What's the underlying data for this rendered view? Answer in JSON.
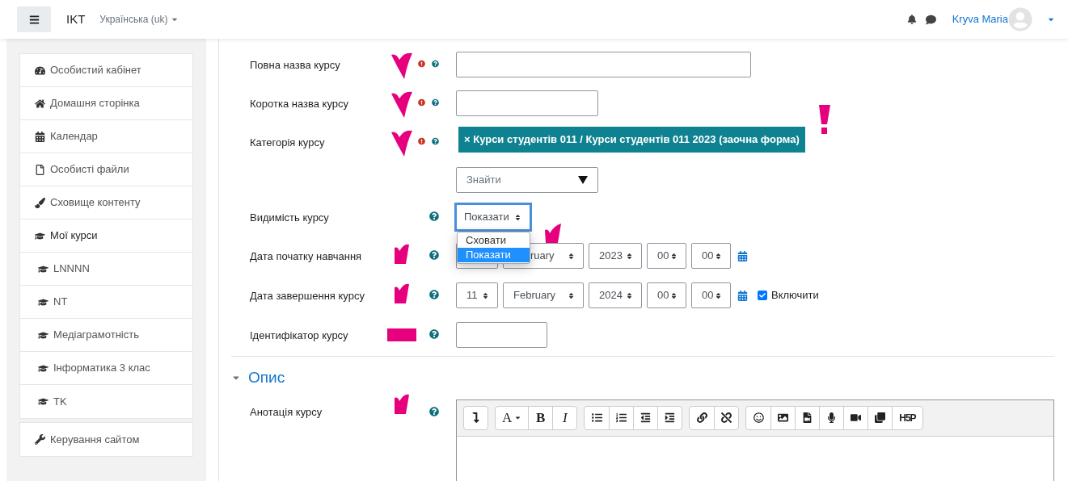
{
  "navbar": {
    "site_name": "IKT",
    "language": "Українська (uk)",
    "user_name": "Kryva Maria"
  },
  "sidebar": {
    "items": [
      {
        "label": "Особистий кабінет",
        "indented": false,
        "selected": false
      },
      {
        "label": "Домашня сторінка",
        "indented": false,
        "selected": false
      },
      {
        "label": "Календар",
        "indented": false,
        "selected": false
      },
      {
        "label": "Особисті файли",
        "indented": false,
        "selected": false
      },
      {
        "label": "Сховище контенту",
        "indented": false,
        "selected": false
      },
      {
        "label": "Мої курси",
        "indented": false,
        "selected": true
      },
      {
        "label": "LNNNN",
        "indented": true,
        "selected": false
      },
      {
        "label": "NT",
        "indented": true,
        "selected": false
      },
      {
        "label": "Медіаграмотність",
        "indented": true,
        "selected": false
      },
      {
        "label": "Інформатика 3 клас",
        "indented": true,
        "selected": false
      },
      {
        "label": "TK",
        "indented": true,
        "selected": false
      }
    ],
    "admin_items": [
      {
        "label": "Керування сайтом",
        "selected": false
      }
    ]
  },
  "form": {
    "rows": [
      {
        "kind": "text",
        "label": "Повна назва курсу",
        "required": true
      },
      {
        "kind": "text",
        "label": "Коротка назва курсу",
        "required": true
      },
      {
        "kind": "category",
        "label": "Категорія курсу",
        "required": true,
        "chip": "× Курси студентів 011 / Курси студентів 011 2023 (заочна форма)",
        "search_placeholder": "Знайти"
      },
      {
        "kind": "select",
        "label": "Видимість курсу",
        "required": false,
        "value": "Показати",
        "focused": true,
        "expanded": true,
        "options": [
          {
            "label": "Сховати",
            "selected": false
          },
          {
            "label": "Показати",
            "selected": true
          }
        ]
      },
      {
        "kind": "date",
        "label": "Дата початку навчання",
        "required": false,
        "parts": [
          {
            "value": "ruary"
          },
          {
            "value": "2023"
          },
          {
            "value": "00"
          },
          {
            "value": "00"
          }
        ]
      },
      {
        "kind": "date",
        "label": "Дата завершення курсу",
        "required": false,
        "parts": [
          {
            "value": "11"
          },
          {
            "value": "February"
          },
          {
            "value": "2024"
          },
          {
            "value": "00"
          },
          {
            "value": "00"
          }
        ],
        "enable": {
          "label": "Включити",
          "checked": true
        }
      },
      {
        "kind": "text",
        "label": "Ідентифікатор курсу",
        "required": false
      }
    ],
    "section": {
      "title": "Опис",
      "expanded": true
    },
    "editor_row": {
      "label": "Анотація курсу",
      "toolbar": [
        [
          {
            "kind": "icon"
          }
        ],
        [
          {
            "text": "A",
            "kind": "serif"
          },
          {
            "text": "B",
            "kind": "bold"
          },
          {
            "text": "I",
            "kind": "italic"
          }
        ],
        [
          {
            "kind": "icon"
          },
          {
            "kind": "icon"
          },
          {
            "kind": "icon"
          },
          {
            "kind": "icon"
          }
        ],
        [
          {
            "kind": "icon"
          },
          {
            "kind": "icon"
          }
        ],
        [
          {
            "kind": "icon"
          },
          {
            "kind": "icon"
          },
          {
            "kind": "icon"
          },
          {
            "kind": "icon"
          },
          {
            "kind": "icon"
          },
          {
            "kind": "icon"
          },
          {
            "text": "H5P",
            "kind": "h5p"
          }
        ]
      ]
    }
  }
}
